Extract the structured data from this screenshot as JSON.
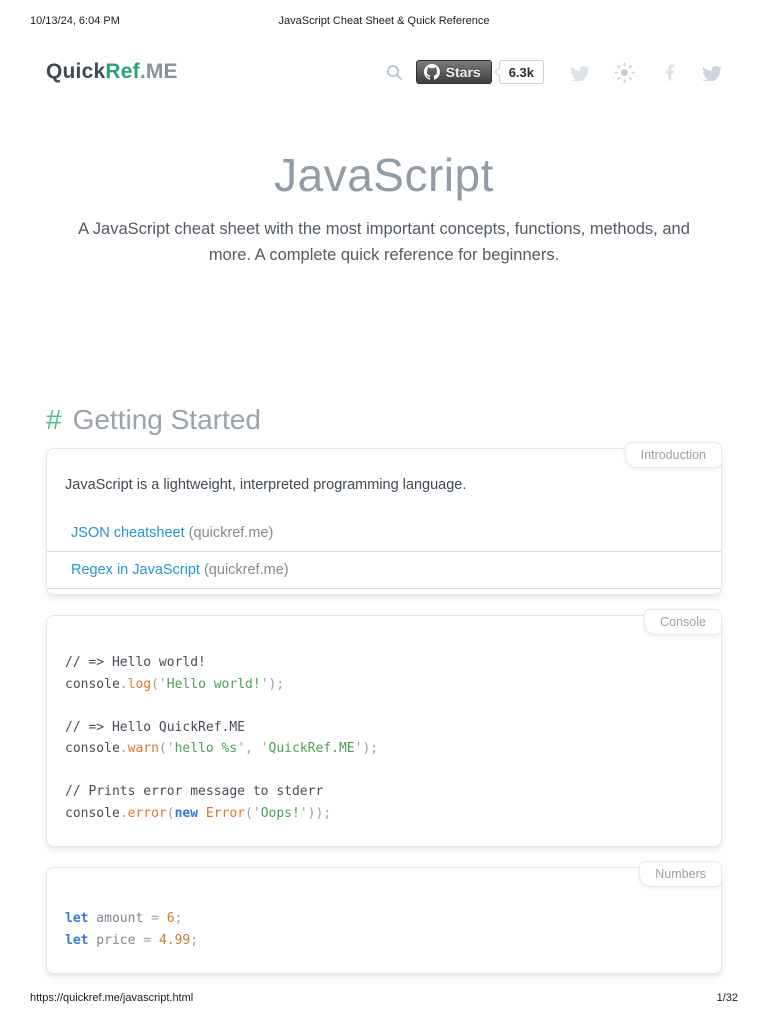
{
  "print": {
    "datetime": "10/13/24, 6:04 PM",
    "doc_title": "JavaScript Cheat Sheet & Quick Reference",
    "url": "https://quickref.me/javascript.html",
    "page_number": "1/32"
  },
  "header": {
    "logo": {
      "part1": "Quick",
      "part2": "Ref",
      "part3": ".ME"
    },
    "github": {
      "button_label": "Stars",
      "star_count": "6.3k"
    },
    "icon_names": [
      "search-icon",
      "github-octocat-icon",
      "twitter-icon",
      "sun-icon",
      "facebook-icon",
      "twitter-icon"
    ]
  },
  "hero": {
    "title": "JavaScript",
    "subtitle": "A JavaScript cheat sheet with the most important concepts, functions, methods, and more. A complete quick reference for beginners."
  },
  "section": {
    "hash": "#",
    "title": "Getting Started"
  },
  "colors": {
    "brand_green": "#29a376",
    "hash_green": "#4cc08d",
    "link_blue": "#2596d1",
    "code_function_orange": "#e0752e",
    "code_string_green": "#4f9e51",
    "code_keyword_blue": "#3879d9",
    "code_number_orange": "#cc7a2e"
  },
  "cards": [
    {
      "tab": "Introduction",
      "paragraph": "JavaScript is a lightweight, interpreted programming language.",
      "links": [
        {
          "label": "JSON cheatsheet",
          "suffix": "(quickref.me)"
        },
        {
          "label": "Regex in JavaScript",
          "suffix": "(quickref.me)"
        }
      ]
    },
    {
      "tab": "Console",
      "code": [
        [
          {
            "c": "cm",
            "t": "// => Hello world!"
          }
        ],
        [
          {
            "c": "pl",
            "t": "console"
          },
          {
            "c": "pu",
            "t": "."
          },
          {
            "c": "fn",
            "t": "log"
          },
          {
            "c": "pu",
            "t": "('"
          },
          {
            "c": "st",
            "t": "Hello world!"
          },
          {
            "c": "pu",
            "t": "');"
          }
        ],
        [],
        [
          {
            "c": "cm",
            "t": "// => Hello QuickRef.ME"
          }
        ],
        [
          {
            "c": "pl",
            "t": "console"
          },
          {
            "c": "pu",
            "t": "."
          },
          {
            "c": "fn",
            "t": "warn"
          },
          {
            "c": "pu",
            "t": "('"
          },
          {
            "c": "st",
            "t": "hello %s"
          },
          {
            "c": "pu",
            "t": "', '"
          },
          {
            "c": "st",
            "t": "QuickRef.ME"
          },
          {
            "c": "pu",
            "t": "');"
          }
        ],
        [],
        [
          {
            "c": "cm",
            "t": "// Prints error message to stderr"
          }
        ],
        [
          {
            "c": "pl",
            "t": "console"
          },
          {
            "c": "pu",
            "t": "."
          },
          {
            "c": "fn",
            "t": "error"
          },
          {
            "c": "pu",
            "t": "("
          },
          {
            "c": "kw",
            "t": "new"
          },
          {
            "c": "pl",
            "t": " "
          },
          {
            "c": "fn",
            "t": "Error"
          },
          {
            "c": "pu",
            "t": "('"
          },
          {
            "c": "st",
            "t": "Oops!"
          },
          {
            "c": "pu",
            "t": "'));"
          }
        ]
      ]
    },
    {
      "tab": "Numbers",
      "code": [
        [
          {
            "c": "kw",
            "t": "let"
          },
          {
            "c": "id",
            "t": " amount "
          },
          {
            "c": "pu",
            "t": "= "
          },
          {
            "c": "nu",
            "t": "6"
          },
          {
            "c": "pu",
            "t": ";"
          }
        ],
        [
          {
            "c": "kw",
            "t": "let"
          },
          {
            "c": "id",
            "t": " price "
          },
          {
            "c": "pu",
            "t": "= "
          },
          {
            "c": "nu",
            "t": "4.99"
          },
          {
            "c": "pu",
            "t": ";"
          }
        ]
      ]
    }
  ]
}
